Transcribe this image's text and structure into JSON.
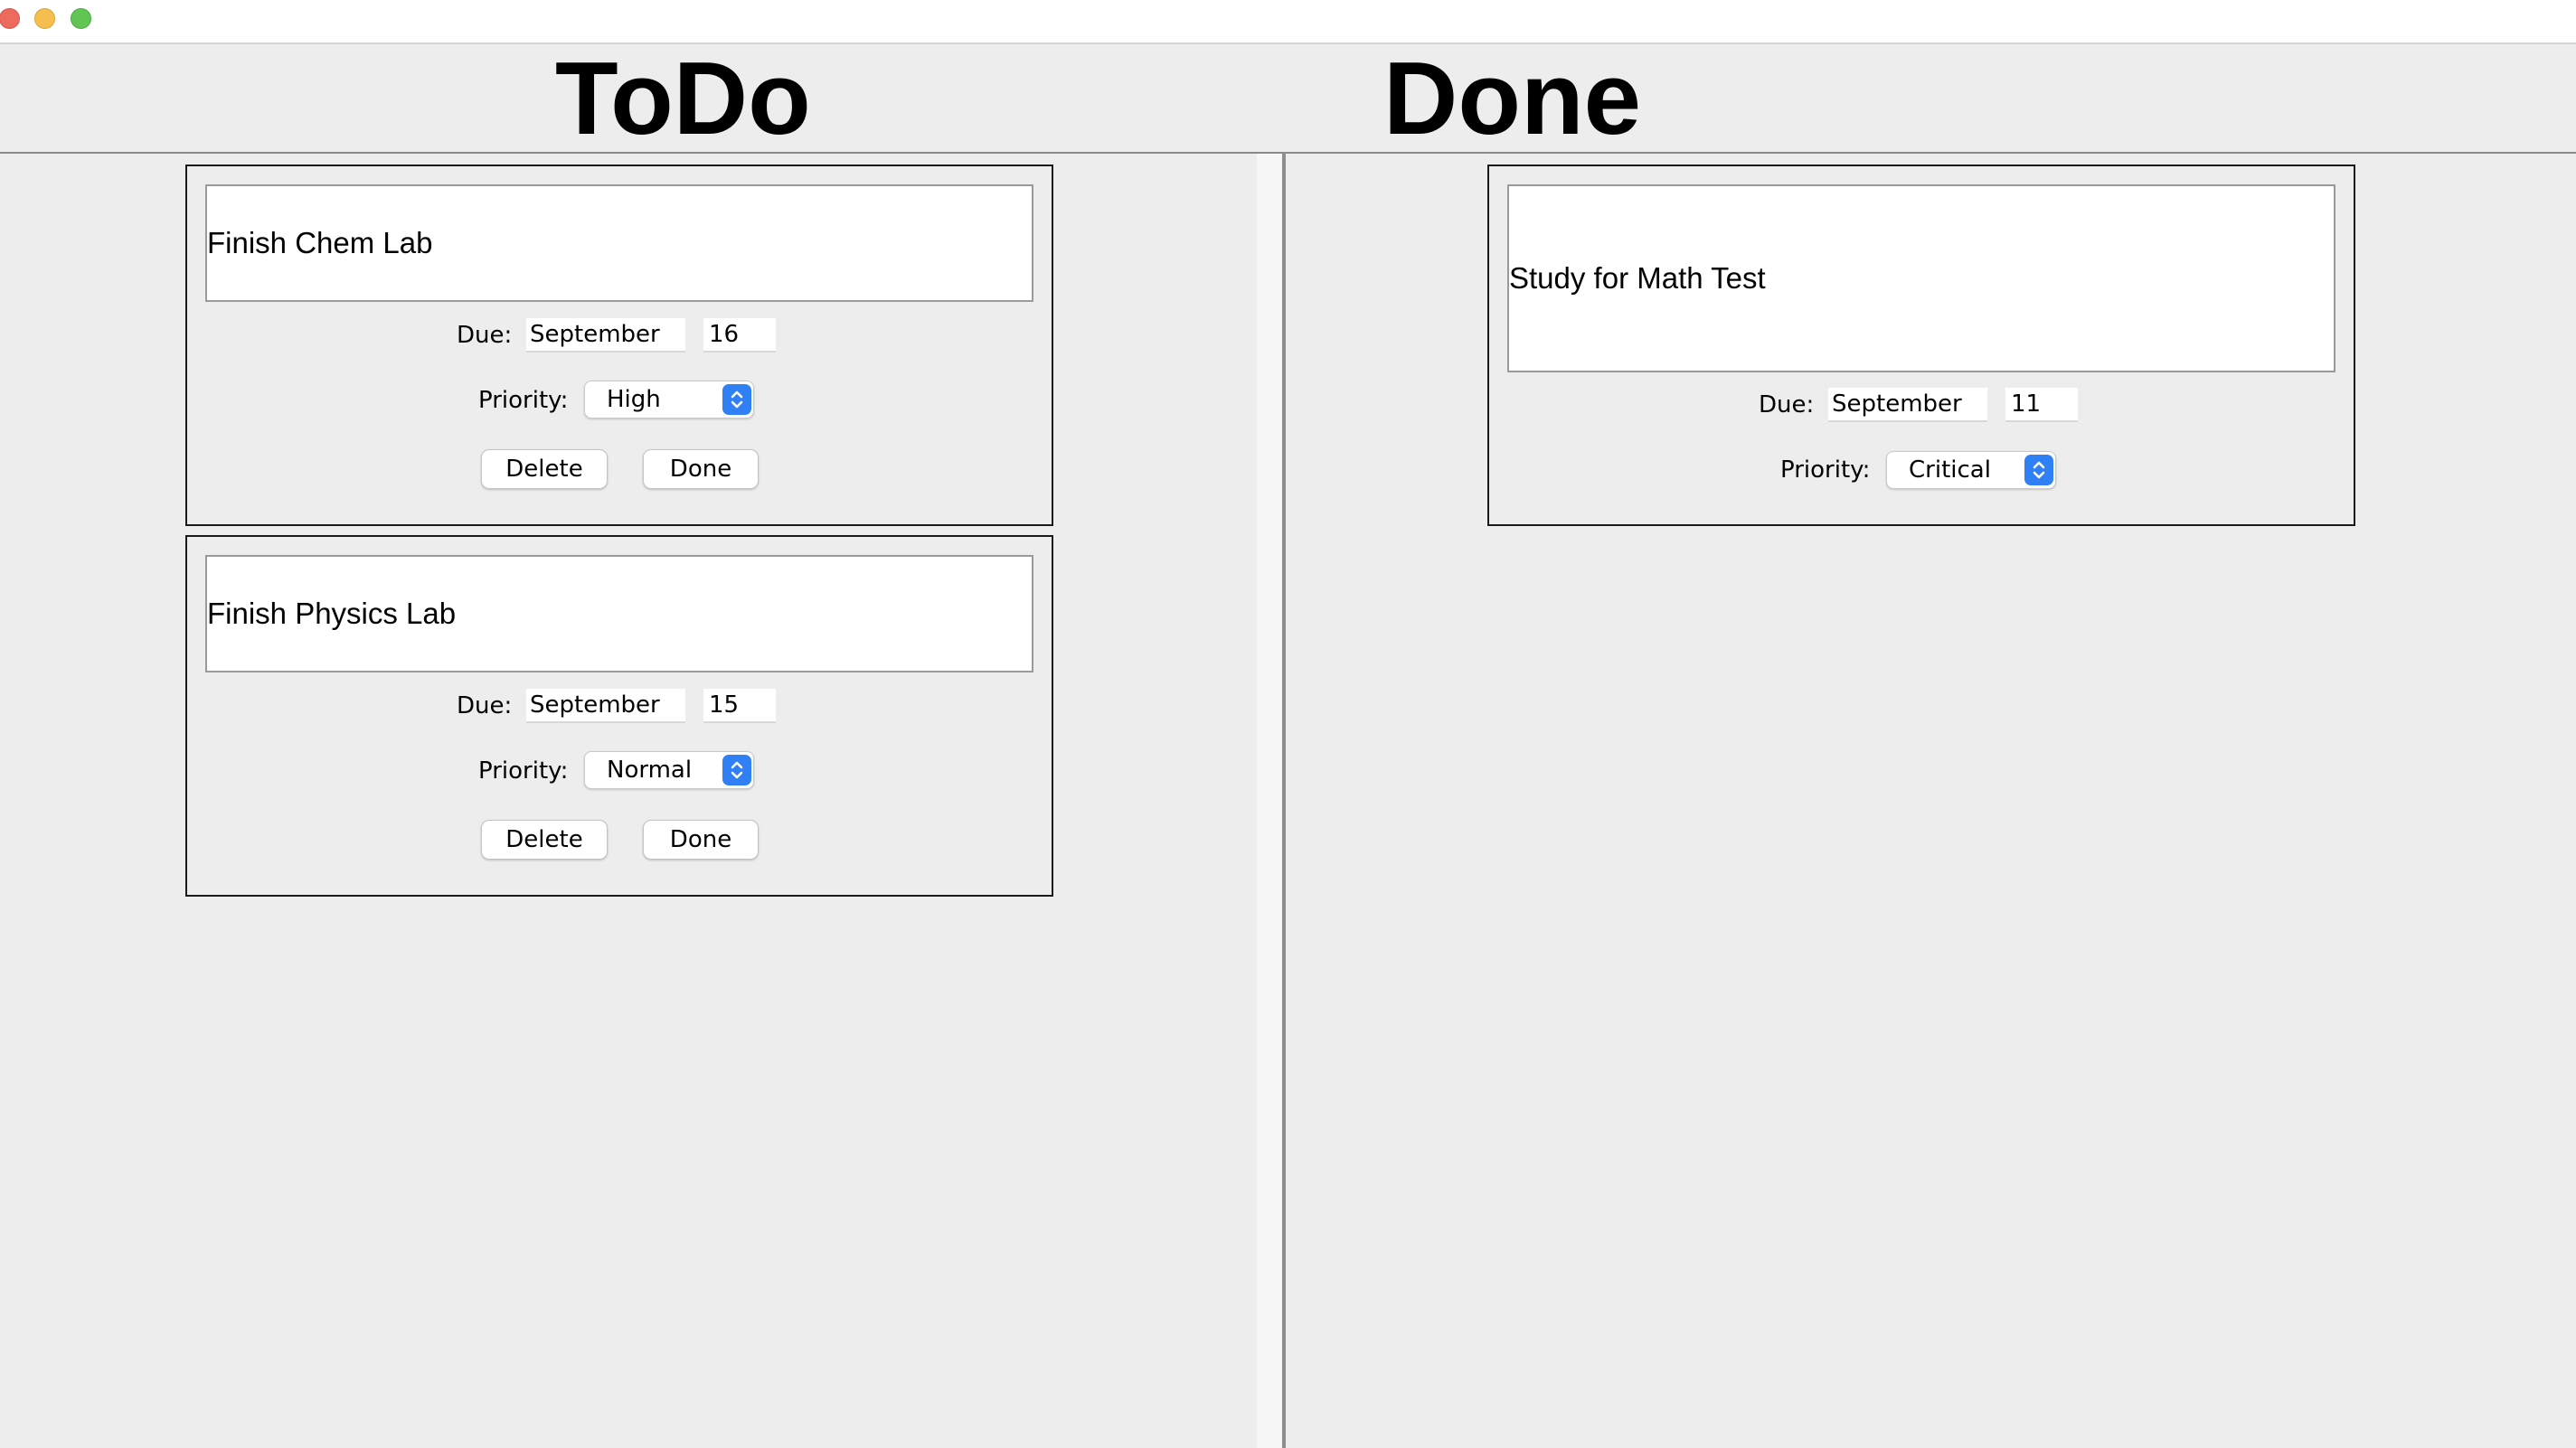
{
  "columns": {
    "todo_title": "ToDo",
    "done_title": "Done"
  },
  "todo": {
    "cards": [
      {
        "title": "Finish Chem Lab",
        "due_label": "Due:",
        "due_month": "September",
        "due_day": "16",
        "priority_label": "Priority:",
        "priority": "High",
        "delete_label": "Delete",
        "done_label": "Done"
      },
      {
        "title": "Finish Physics Lab",
        "due_label": "Due:",
        "due_month": "September",
        "due_day": "15",
        "priority_label": "Priority:",
        "priority": "Normal",
        "delete_label": "Delete",
        "done_label": "Done"
      }
    ]
  },
  "done": {
    "cards": [
      {
        "title": "Study for Math Test",
        "due_label": "Due:",
        "due_month": "September",
        "due_day": "11",
        "priority_label": "Priority:",
        "priority": "Critical"
      }
    ]
  },
  "colors": {
    "window_bg": "#ededed",
    "accent_blue": "#2f7ff5",
    "close": "#ed6a5e",
    "minimize": "#f5bf4f",
    "maximize": "#61c554"
  }
}
